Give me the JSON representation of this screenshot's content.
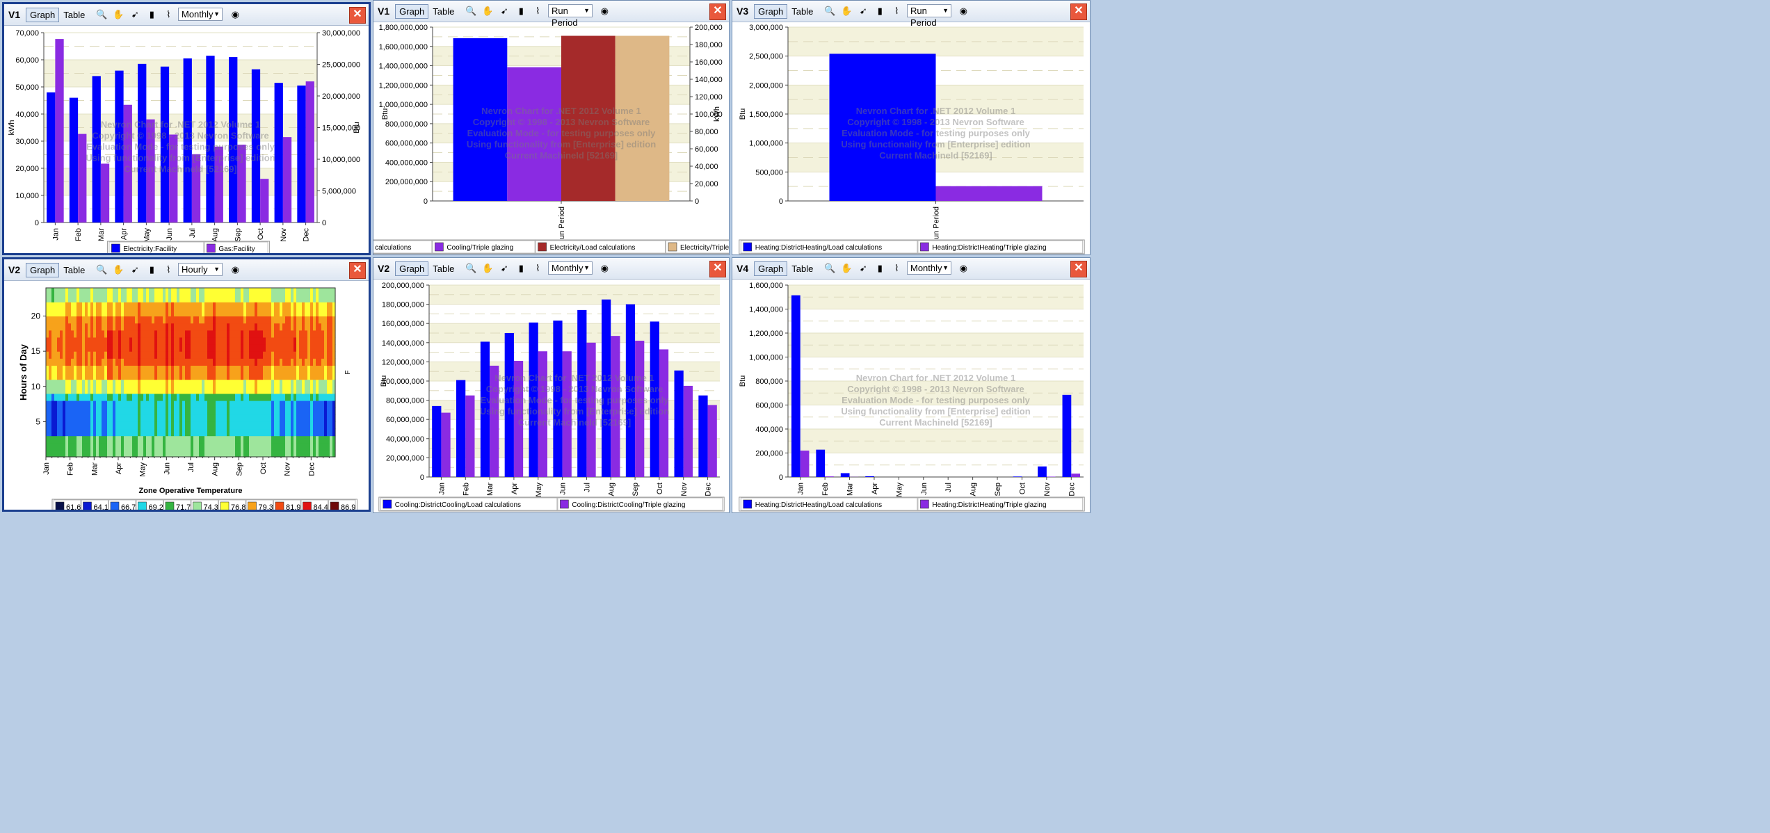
{
  "toolbar": {
    "graph_label": "Graph",
    "table_label": "Table"
  },
  "panels": [
    {
      "id": "p1",
      "title": "V1",
      "period": "Monthly"
    },
    {
      "id": "p2",
      "title": "V1",
      "period": "Run Period"
    },
    {
      "id": "p3",
      "title": "V3",
      "period": "Run Period"
    },
    {
      "id": "p4",
      "title": "V2",
      "period": "Hourly"
    },
    {
      "id": "p5",
      "title": "V2",
      "period": "Monthly"
    },
    {
      "id": "p6",
      "title": "V4",
      "period": "Monthly"
    }
  ],
  "watermark": [
    "Nevron Chart for .NET 2012 Volume 1",
    "Copyright © 1998 - 2013 Nevron Software",
    "Evaluation Mode - for testing purposes only",
    "Using functionality from [Enterprise] edition",
    "Current MachineId [52169]"
  ],
  "colors": {
    "blue": "#0000ff",
    "purple": "#8a2be2",
    "darkred": "#a52a2a",
    "tan": "#deb887",
    "band": "#f3f2dc"
  },
  "chart_data": [
    {
      "panel": "p1",
      "type": "bar",
      "categories": [
        "Jan",
        "Feb",
        "Mar",
        "Apr",
        "May",
        "Jun",
        "Jul",
        "Aug",
        "Sep",
        "Oct",
        "Nov",
        "Dec"
      ],
      "ylabel": "kWh",
      "ylabel_right": "Btu",
      "ylim": [
        0,
        70000
      ],
      "ylim_right": [
        0,
        30000000
      ],
      "yticks": [
        "0",
        "10,000",
        "20,000",
        "30,000",
        "40,000",
        "50,000",
        "60,000",
        "70,000"
      ],
      "yticks_right": [
        "0",
        "5,000,000",
        "10,000,000",
        "15,000,000",
        "20,000,000",
        "25,000,000",
        "30,000,000"
      ],
      "series": [
        {
          "name": "Electricity:Facility",
          "axis": "left",
          "color": "#0000ff",
          "values": [
            48000,
            46000,
            54000,
            56000,
            58500,
            57500,
            60500,
            61500,
            61000,
            56500,
            51500,
            50500
          ]
        },
        {
          "name": "Gas:Facility",
          "axis": "right",
          "color": "#8a2be2",
          "values": [
            29000000,
            14000000,
            9300000,
            18600000,
            16300000,
            13900000,
            10800000,
            12000000,
            12300000,
            6900000,
            13500000,
            22300000
          ]
        }
      ]
    },
    {
      "panel": "p2",
      "type": "bar",
      "categories": [
        "Run Period"
      ],
      "ylabel": "Btu",
      "ylabel_right": "kWh",
      "ylim": [
        0,
        1800000000
      ],
      "ylim_right": [
        0,
        200000
      ],
      "yticks": [
        "0",
        "200,000,000",
        "400,000,000",
        "600,000,000",
        "800,000,000",
        "1,000,000,000",
        "1,200,000,000",
        "1,400,000,000",
        "1,600,000,000",
        "1,800,000,000"
      ],
      "yticks_right": [
        "0",
        "20,000",
        "40,000",
        "60,000",
        "80,000",
        "100,000",
        "120,000",
        "140,000",
        "160,000",
        "180,000",
        "200,000"
      ],
      "series": [
        {
          "name": "Cooling/Load calculations",
          "axis": "left",
          "color": "#0000ff",
          "values": [
            1685000000
          ]
        },
        {
          "name": "Cooling/Triple glazing",
          "axis": "left",
          "color": "#8a2be2",
          "values": [
            1385000000
          ]
        },
        {
          "name": "Electricity/Load calculations",
          "axis": "right",
          "color": "#a52a2a",
          "values": [
            190000
          ]
        },
        {
          "name": "Electricity/Triple glazing",
          "axis": "right",
          "color": "#deb887",
          "values": [
            190000
          ]
        }
      ]
    },
    {
      "panel": "p3",
      "type": "bar",
      "categories": [
        "Run Period"
      ],
      "ylabel": "Btu",
      "ylim": [
        0,
        3000000
      ],
      "yticks": [
        "0",
        "500,000",
        "1,000,000",
        "1,500,000",
        "2,000,000",
        "2,500,000",
        "3,000,000"
      ],
      "series": [
        {
          "name": "Heating:DistrictHeating/Load calculations",
          "color": "#0000ff",
          "values": [
            2540000
          ]
        },
        {
          "name": "Heating:DistrictHeating/Triple glazing",
          "color": "#8a2be2",
          "values": [
            255000
          ]
        }
      ]
    },
    {
      "panel": "p4",
      "type": "heatmap",
      "xlabel": "Zone Operative Temperature",
      "ylabel": "Hours of Day",
      "unit": "F",
      "categories": [
        "Jan",
        "Feb",
        "Mar",
        "Apr",
        "May",
        "Jun",
        "Jul",
        "Aug",
        "Sep",
        "Oct",
        "Nov",
        "Dec"
      ],
      "yticks": [
        "5",
        "10",
        "15",
        "20"
      ],
      "legend": [
        {
          "label": "61.6",
          "color": "#08104a"
        },
        {
          "label": "64.1",
          "color": "#0a1ad2"
        },
        {
          "label": "66.7",
          "color": "#1a64f5"
        },
        {
          "label": "69.2",
          "color": "#21d8e6"
        },
        {
          "label": "71.7",
          "color": "#35b441"
        },
        {
          "label": "74.3",
          "color": "#9ee59c"
        },
        {
          "label": "76.8",
          "color": "#ffff33"
        },
        {
          "label": "79.3",
          "color": "#f7a21b"
        },
        {
          "label": "81.9",
          "color": "#f24b12"
        },
        {
          "label": "84.4",
          "color": "#e01111"
        },
        {
          "label": "86.9",
          "color": "#6e0a0a"
        }
      ]
    },
    {
      "panel": "p5",
      "type": "bar",
      "categories": [
        "Jan",
        "Feb",
        "Mar",
        "Apr",
        "May",
        "Jun",
        "Jul",
        "Aug",
        "Sep",
        "Oct",
        "Nov",
        "Dec"
      ],
      "ylabel": "Btu",
      "ylim": [
        0,
        200000000
      ],
      "yticks": [
        "0",
        "20,000,000",
        "40,000,000",
        "60,000,000",
        "80,000,000",
        "100,000,000",
        "120,000,000",
        "140,000,000",
        "160,000,000",
        "180,000,000",
        "200,000,000"
      ],
      "series": [
        {
          "name": "Cooling:DistrictCooling/Load calculations",
          "color": "#0000ff",
          "values": [
            74000000,
            101000000,
            141000000,
            150000000,
            161000000,
            163000000,
            174000000,
            185000000,
            180000000,
            162000000,
            111000000,
            85000000
          ]
        },
        {
          "name": "Cooling:DistrictCooling/Triple glazing",
          "color": "#8a2be2",
          "values": [
            67000000,
            85000000,
            116000000,
            121000000,
            131000000,
            131000000,
            140000000,
            147000000,
            142000000,
            133000000,
            95000000,
            75000000
          ]
        }
      ]
    },
    {
      "panel": "p6",
      "type": "bar",
      "categories": [
        "Jan",
        "Feb",
        "Mar",
        "Apr",
        "May",
        "Jun",
        "Jul",
        "Aug",
        "Sep",
        "Oct",
        "Nov",
        "Dec"
      ],
      "ylabel": "Btu",
      "ylim": [
        0,
        1600000
      ],
      "yticks": [
        "0",
        "200,000",
        "400,000",
        "600,000",
        "800,000",
        "1,000,000",
        "1,200,000",
        "1,400,000",
        "1,600,000"
      ],
      "series": [
        {
          "name": "Heating:DistrictHeating/Load calculations",
          "color": "#0000ff",
          "values": [
            1515000,
            228000,
            32000,
            6000,
            0,
            0,
            0,
            0,
            0,
            4000,
            88000,
            685000
          ]
        },
        {
          "name": "Heating:DistrictHeating/Triple glazing",
          "color": "#8a2be2",
          "values": [
            220000,
            5000,
            1000,
            0,
            0,
            0,
            0,
            0,
            0,
            0,
            3000,
            28000
          ]
        }
      ]
    }
  ]
}
